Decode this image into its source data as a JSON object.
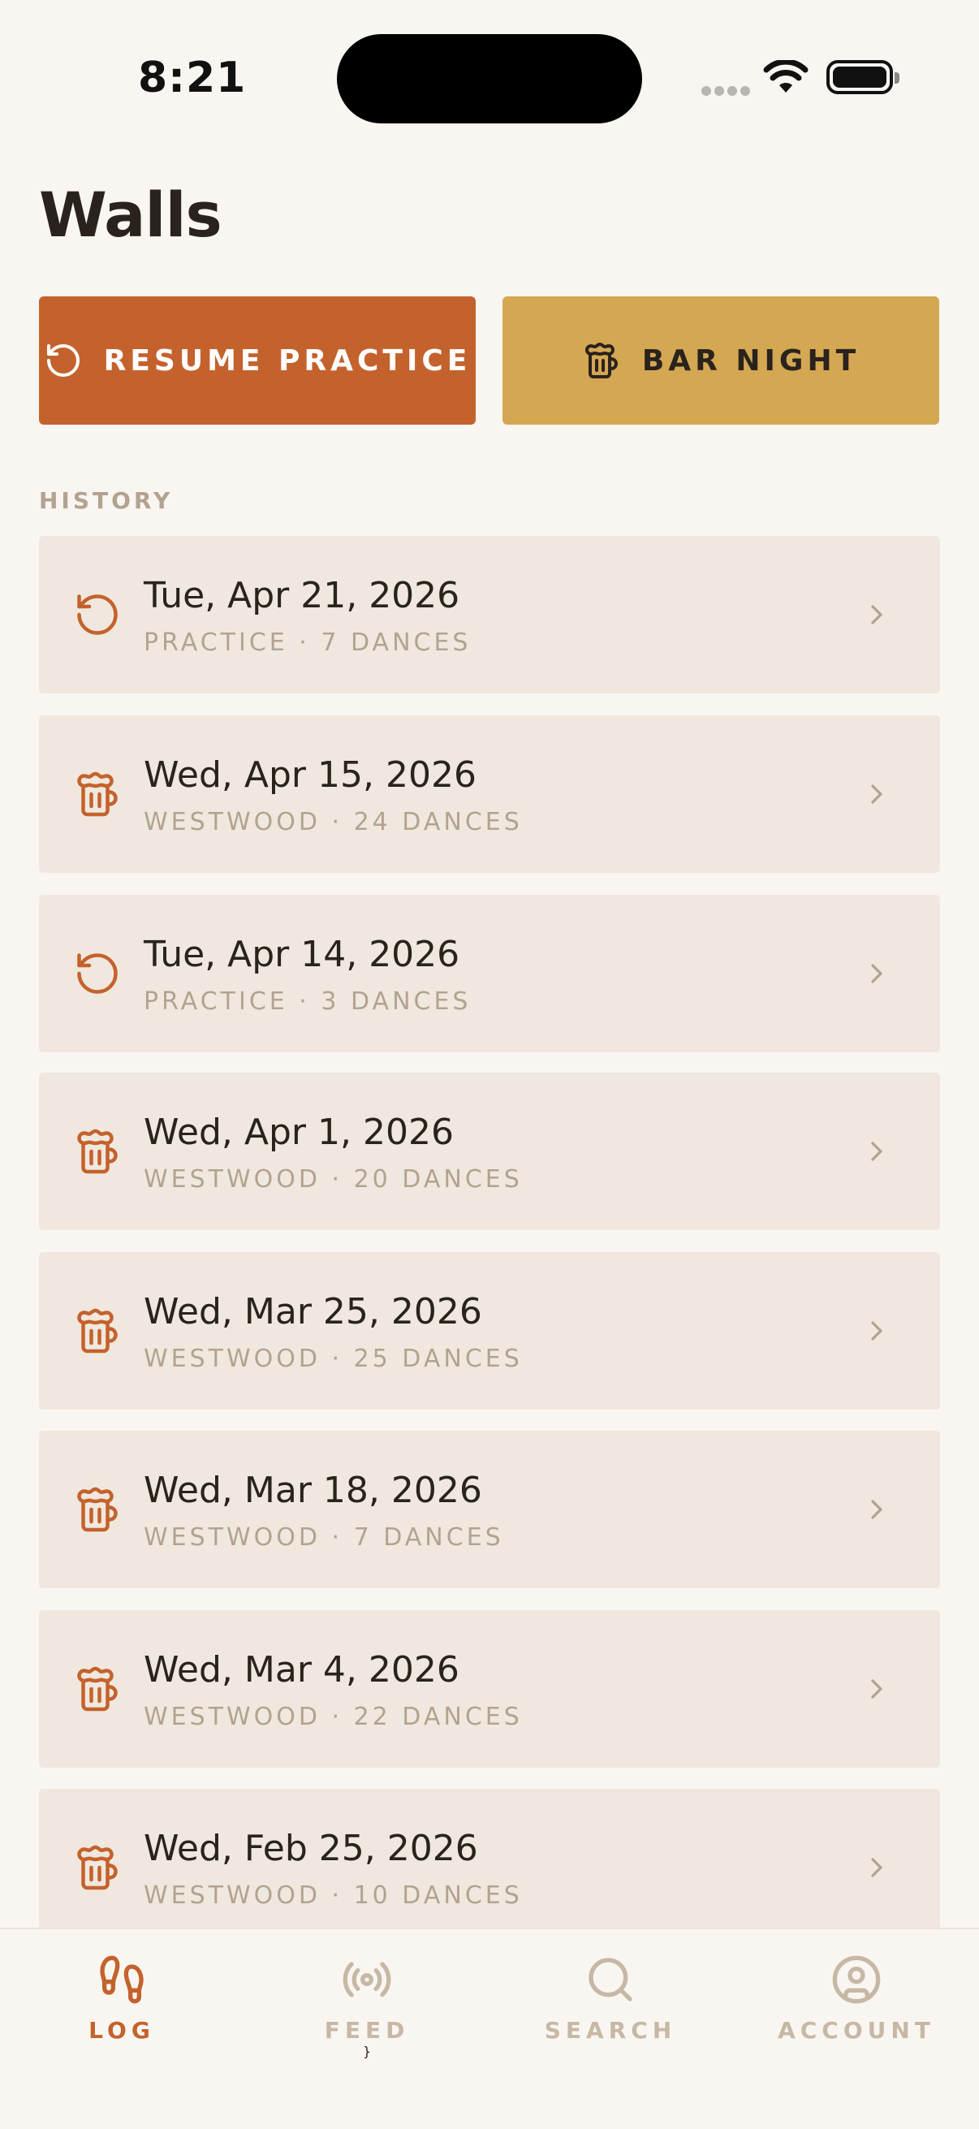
{
  "status_bar": {
    "time": "8:21"
  },
  "page": {
    "title": "Walls"
  },
  "actions": {
    "resume_label": "RESUME PRACTICE",
    "bar_label": "BAR NIGHT"
  },
  "history": {
    "section_label": "HISTORY",
    "items": [
      {
        "date": "Tue, Apr 21, 2026",
        "meta": "PRACTICE · 7 DANCES",
        "icon": "refresh-icon"
      },
      {
        "date": "Wed, Apr 15, 2026",
        "meta": "WESTWOOD · 24 DANCES",
        "icon": "beer-mug-icon"
      },
      {
        "date": "Tue, Apr 14, 2026",
        "meta": "PRACTICE · 3 DANCES",
        "icon": "refresh-icon"
      },
      {
        "date": "Wed, Apr 1, 2026",
        "meta": "WESTWOOD · 20 DANCES",
        "icon": "beer-mug-icon"
      },
      {
        "date": "Wed, Mar 25, 2026",
        "meta": "WESTWOOD · 25 DANCES",
        "icon": "beer-mug-icon"
      },
      {
        "date": "Wed, Mar 18, 2026",
        "meta": "WESTWOOD · 7 DANCES",
        "icon": "beer-mug-icon"
      },
      {
        "date": "Wed, Mar 4, 2026",
        "meta": "WESTWOOD · 22 DANCES",
        "icon": "beer-mug-icon"
      },
      {
        "date": "Wed, Feb 25, 2026",
        "meta": "WESTWOOD · 10 DANCES",
        "icon": "beer-mug-icon"
      }
    ]
  },
  "tabs": [
    {
      "label": "LOG",
      "icon": "footprints-icon",
      "active": true
    },
    {
      "label": "FEED",
      "icon": "broadcast-icon",
      "active": false
    },
    {
      "label": "SEARCH",
      "icon": "search-icon",
      "active": false
    },
    {
      "label": "ACCOUNT",
      "icon": "user-circle-icon",
      "active": false
    }
  ],
  "colors": {
    "accent": "#c4622d",
    "gold": "#d4a752",
    "background": "#f9f6f1",
    "card": "#f0e8de",
    "muted": "#b2a391"
  }
}
